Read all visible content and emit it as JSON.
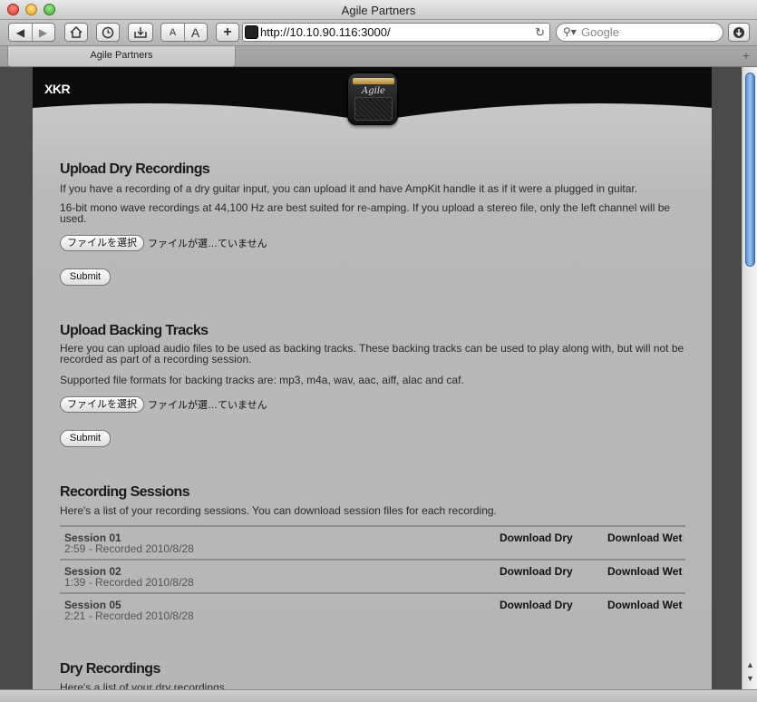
{
  "window": {
    "title": "Agile Partners"
  },
  "toolbar": {
    "font_small": "A",
    "font_large": "A",
    "add": "+",
    "url": "http://10.10.90.116:3000/",
    "search_placeholder": "Google"
  },
  "tabs": [
    {
      "label": "Agile Partners"
    }
  ],
  "header": {
    "brand": "XKR",
    "icon_logo": "Agile"
  },
  "upload_dry": {
    "title": "Upload Dry Recordings",
    "desc1": "If you have a recording of a dry guitar input, you can upload it and have AmpKit handle it as if it were a plugged in guitar.",
    "desc2": "16-bit mono wave recordings at 44,100 Hz are best suited for re-amping. If you upload a stereo file, only the left channel will be used.",
    "file_button": "ファイルを選択",
    "file_status": "ファイルが選…ていません",
    "submit": "Submit"
  },
  "upload_backing": {
    "title": "Upload Backing Tracks",
    "desc1": "Here you can upload audio files to be used as backing tracks. These backing tracks can be used to play along with, but will not be recorded as part of a recording session.",
    "desc2": "Supported file formats for backing tracks are: mp3, m4a, wav, aac, aiff, alac and caf.",
    "file_button": "ファイルを選択",
    "file_status": "ファイルが選…ていません",
    "submit": "Submit"
  },
  "sessions": {
    "title": "Recording Sessions",
    "desc": "Here's a list of your recording sessions. You can download session files for each recording.",
    "rows": [
      {
        "name": "Session 01",
        "info": "2:59 - Recorded 2010/8/28",
        "dry": "Download Dry",
        "wet": "Download Wet"
      },
      {
        "name": "Session 02",
        "info": "1:39 - Recorded 2010/8/28",
        "dry": "Download Dry",
        "wet": "Download Wet"
      },
      {
        "name": "Session 05",
        "info": "2:21 - Recorded 2010/8/28",
        "dry": "Download Dry",
        "wet": "Download Wet"
      }
    ]
  },
  "dry_recordings": {
    "title": "Dry Recordings",
    "desc": "Here's a list of your dry recordings."
  }
}
